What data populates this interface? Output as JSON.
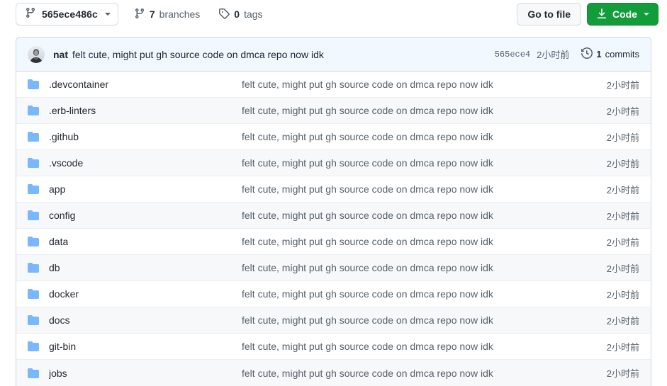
{
  "toolbar": {
    "branch_name": "565ece486c",
    "branch_icon": "git-branch-icon",
    "branches_count": "7",
    "branches_label": "branches",
    "tags_count": "0",
    "tags_label": "tags",
    "tag_icon": "tag-icon",
    "go_to_file_label": "Go to file",
    "code_label": "Code",
    "code_icon": "download-icon",
    "code_button_color": "#139c3a"
  },
  "commit_header": {
    "author": "nat",
    "message": "felt cute, might put gh source code on dmca repo now idk",
    "sha": "565ece4",
    "time": "2小时前",
    "history_icon": "history-clock-icon",
    "commits_count": "1",
    "commits_label": "commits",
    "background_color": "#f1f8ff"
  },
  "file_list": {
    "folder_icon": "folder-icon",
    "folder_color": "#79b8ff",
    "rows": [
      {
        "name": ".devcontainer",
        "message": "felt cute, might put gh source code on dmca repo now idk",
        "time": "2小时前"
      },
      {
        "name": ".erb-linters",
        "message": "felt cute, might put gh source code on dmca repo now idk",
        "time": "2小时前"
      },
      {
        "name": ".github",
        "message": "felt cute, might put gh source code on dmca repo now idk",
        "time": "2小时前"
      },
      {
        "name": ".vscode",
        "message": "felt cute, might put gh source code on dmca repo now idk",
        "time": "2小时前"
      },
      {
        "name": "app",
        "message": "felt cute, might put gh source code on dmca repo now idk",
        "time": "2小时前"
      },
      {
        "name": "config",
        "message": "felt cute, might put gh source code on dmca repo now idk",
        "time": "2小时前"
      },
      {
        "name": "data",
        "message": "felt cute, might put gh source code on dmca repo now idk",
        "time": "2小时前"
      },
      {
        "name": "db",
        "message": "felt cute, might put gh source code on dmca repo now idk",
        "time": "2小时前"
      },
      {
        "name": "docker",
        "message": "felt cute, might put gh source code on dmca repo now idk",
        "time": "2小时前"
      },
      {
        "name": "docs",
        "message": "felt cute, might put gh source code on dmca repo now idk",
        "time": "2小时前"
      },
      {
        "name": "git-bin",
        "message": "felt cute, might put gh source code on dmca repo now idk",
        "time": "2小时前"
      },
      {
        "name": "jobs",
        "message": "felt cute, might put gh source code on dmca repo now idk",
        "time": "2小时前"
      }
    ]
  }
}
